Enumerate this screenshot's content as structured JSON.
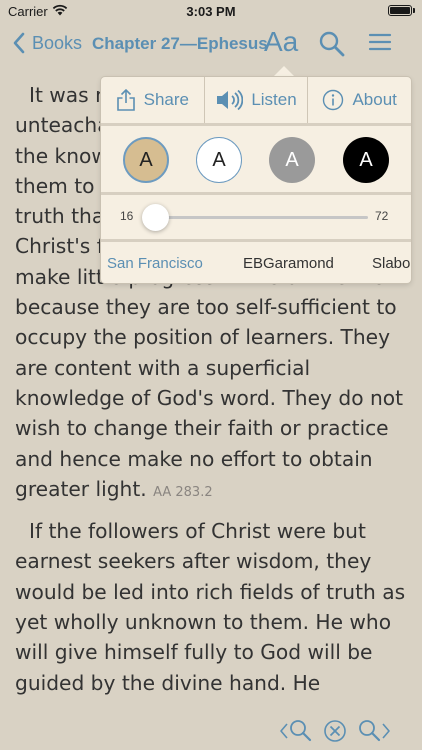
{
  "status_bar": {
    "carrier": "Carrier",
    "time": "3:03 PM",
    "battery_level": 1.0
  },
  "nav": {
    "back_label": "Books",
    "title": "Chapter 27—Ephesus",
    "font_button_label": "Aa",
    "icons": [
      "chevron-left-icon",
      "search-icon",
      "hamburger-menu-icon"
    ]
  },
  "content": {
    "paragraph1": "It was not that they were unteachable, but they had not gained the knowledge that would enable them to gather the rich harvest of truth that was then being given to Christ's followers. There are many who make little progress in the divine life because they are too self-sufficient to occupy the position of learners. They are content with a superficial knowledge of God's word. They do not wish to change their faith or practice and hence make no effort to obtain greater light.",
    "paragraph1_ref": "AA 283.2",
    "paragraph2": "If the followers of Christ were but earnest seekers after wisdom, they would be led into rich fields of truth as yet wholly unknown to them. He who will give himself fully to God will be guided by the divine hand. He"
  },
  "popover": {
    "actions": [
      {
        "label": "Share",
        "icon": "share-icon"
      },
      {
        "label": "Listen",
        "icon": "speaker-icon"
      },
      {
        "label": "About",
        "icon": "info-icon"
      }
    ],
    "themes": [
      {
        "label": "A",
        "name": "sepia",
        "color": "#d6bd91",
        "selected": true
      },
      {
        "label": "A",
        "name": "white",
        "color": "#ffffff",
        "selected": false
      },
      {
        "label": "A",
        "name": "gray",
        "color": "#9a9a9a",
        "selected": false
      },
      {
        "label": "A",
        "name": "black",
        "color": "#000000",
        "selected": false
      }
    ],
    "font_size": {
      "min": "16",
      "max": "72",
      "value": 19
    },
    "fonts": [
      {
        "label": "San Francisco",
        "selected": true
      },
      {
        "label": "EBGaramond",
        "selected": false
      },
      {
        "label": "Slabo",
        "selected": false
      }
    ]
  },
  "bottom_bar": {
    "icons": [
      "search-previous-icon",
      "clear-search-icon",
      "search-next-icon"
    ]
  },
  "colors": {
    "accent": "#5b8fb3",
    "background": "#d9d2c4",
    "popover_bg": "#f6efe2"
  }
}
